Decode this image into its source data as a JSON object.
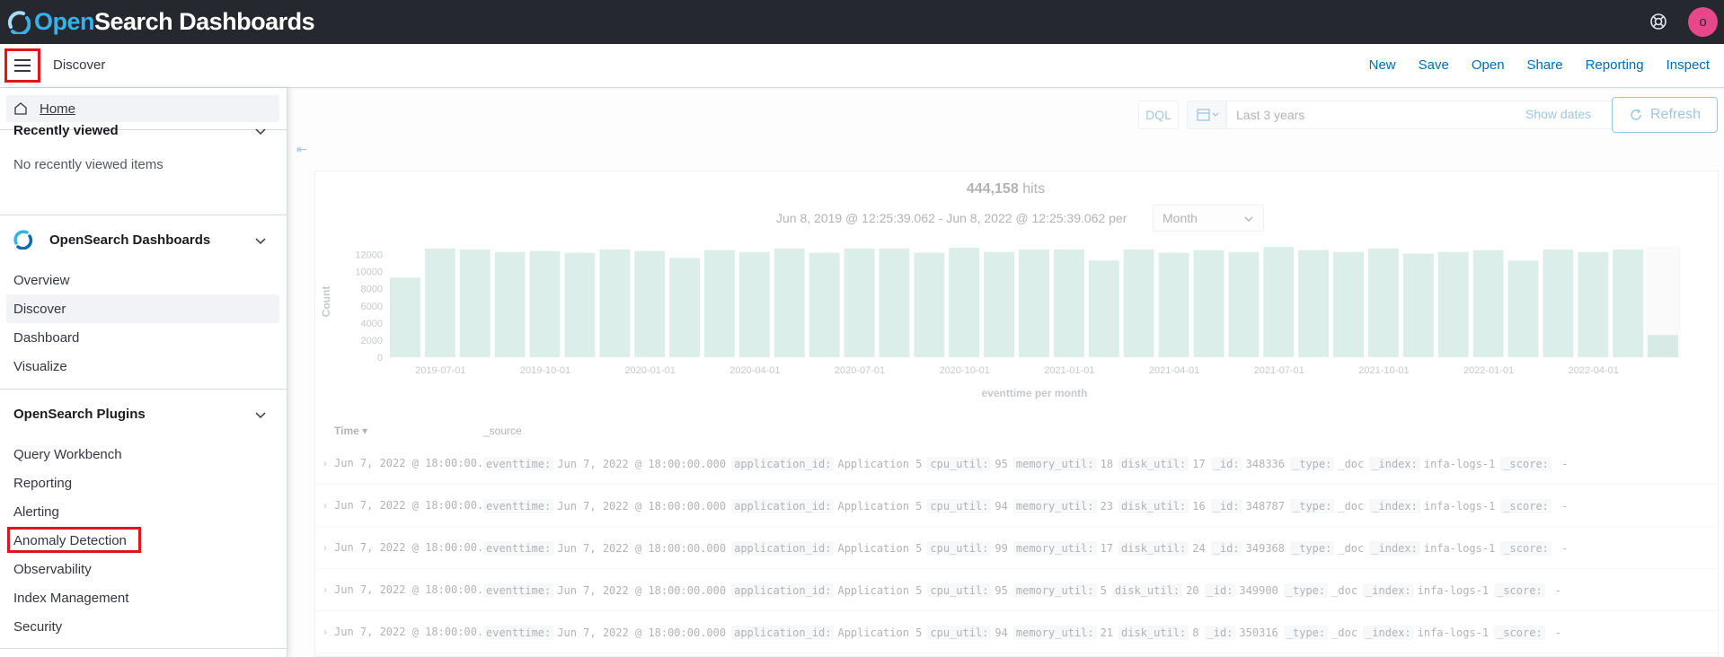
{
  "header": {
    "logo_open": "Open",
    "logo_rest": "Search Dashboards",
    "avatar_initial": "o"
  },
  "subheader": {
    "breadcrumb": "Discover",
    "actions": [
      "New",
      "Save",
      "Open",
      "Share",
      "Reporting",
      "Inspect"
    ]
  },
  "sidebar": {
    "home": "Home",
    "recently_viewed": {
      "title": "Recently viewed",
      "empty_text": "No recently viewed items"
    },
    "osd_section": {
      "title": "OpenSearch Dashboards",
      "items": [
        "Overview",
        "Discover",
        "Dashboard",
        "Visualize"
      ],
      "active_item": "Discover"
    },
    "plugins_section": {
      "title": "OpenSearch Plugins",
      "items": [
        "Query Workbench",
        "Reporting",
        "Alerting",
        "Anomaly Detection",
        "Observability",
        "Index Management",
        "Security"
      ],
      "highlighted_item": "Anomaly Detection"
    }
  },
  "query_bar": {
    "language": "DQL",
    "time_range": "Last 3 years",
    "show_dates": "Show dates",
    "refresh": "Refresh"
  },
  "histogram": {
    "hits_count": "444,158",
    "hits_label": "hits",
    "date_range": "Jun 8, 2019 @ 12:25:39.062 - Jun 8, 2022 @ 12:25:39.062 per",
    "interval": "Month",
    "chart_data": {
      "type": "bar",
      "ylabel": "Count",
      "xlabel": "eventtime per month",
      "ylim": [
        0,
        13000
      ],
      "yticks": [
        0,
        2000,
        4000,
        6000,
        8000,
        10000,
        12000
      ],
      "xtick_labels": [
        "2019-07-01",
        "2019-10-01",
        "2020-01-01",
        "2020-04-01",
        "2020-07-01",
        "2020-10-01",
        "2021-01-01",
        "2021-04-01",
        "2021-07-01",
        "2021-10-01",
        "2022-01-01",
        "2022-04-01"
      ],
      "values": [
        9300,
        12700,
        12600,
        12300,
        12400,
        12200,
        12600,
        12400,
        11600,
        12500,
        12300,
        12700,
        12200,
        12700,
        12700,
        12200,
        12800,
        12300,
        12600,
        12600,
        11300,
        12600,
        12200,
        12500,
        12300,
        12900,
        12500,
        12300,
        12700,
        12100,
        12300,
        12500,
        11300,
        12600,
        12300,
        12600,
        2600
      ]
    }
  },
  "table": {
    "time_header": "Time",
    "source_header": "_source",
    "rows": [
      {
        "time": "Jun 7, 2022 @ 18:00:00.000",
        "fields": [
          [
            "eventtime:",
            "Jun 7, 2022 @ 18:00:00.000"
          ],
          [
            "application_id:",
            "Application 5"
          ],
          [
            "cpu_util:",
            "95"
          ],
          [
            "memory_util:",
            "18"
          ],
          [
            "disk_util:",
            "17"
          ],
          [
            "_id:",
            "348336"
          ],
          [
            "_type:",
            "_doc"
          ],
          [
            "_index:",
            "infa-logs-1"
          ],
          [
            "_score:",
            " - "
          ]
        ]
      },
      {
        "time": "Jun 7, 2022 @ 18:00:00.000",
        "fields": [
          [
            "eventtime:",
            "Jun 7, 2022 @ 18:00:00.000"
          ],
          [
            "application_id:",
            "Application 5"
          ],
          [
            "cpu_util:",
            "94"
          ],
          [
            "memory_util:",
            "23"
          ],
          [
            "disk_util:",
            "16"
          ],
          [
            "_id:",
            "348787"
          ],
          [
            "_type:",
            "_doc"
          ],
          [
            "_index:",
            "infa-logs-1"
          ],
          [
            "_score:",
            " - "
          ]
        ]
      },
      {
        "time": "Jun 7, 2022 @ 18:00:00.000",
        "fields": [
          [
            "eventtime:",
            "Jun 7, 2022 @ 18:00:00.000"
          ],
          [
            "application_id:",
            "Application 5"
          ],
          [
            "cpu_util:",
            "99"
          ],
          [
            "memory_util:",
            "17"
          ],
          [
            "disk_util:",
            "24"
          ],
          [
            "_id:",
            "349368"
          ],
          [
            "_type:",
            "_doc"
          ],
          [
            "_index:",
            "infa-logs-1"
          ],
          [
            "_score:",
            " - "
          ]
        ]
      },
      {
        "time": "Jun 7, 2022 @ 18:00:00.000",
        "fields": [
          [
            "eventtime:",
            "Jun 7, 2022 @ 18:00:00.000"
          ],
          [
            "application_id:",
            "Application 5"
          ],
          [
            "cpu_util:",
            "95"
          ],
          [
            "memory_util:",
            "5"
          ],
          [
            "disk_util:",
            "20"
          ],
          [
            "_id:",
            "349900"
          ],
          [
            "_type:",
            "_doc"
          ],
          [
            "_index:",
            "infa-logs-1"
          ],
          [
            "_score:",
            " - "
          ]
        ]
      },
      {
        "time": "Jun 7, 2022 @ 18:00:00.000",
        "fields": [
          [
            "eventtime:",
            "Jun 7, 2022 @ 18:00:00.000"
          ],
          [
            "application_id:",
            "Application 5"
          ],
          [
            "cpu_util:",
            "94"
          ],
          [
            "memory_util:",
            "21"
          ],
          [
            "disk_util:",
            "8"
          ],
          [
            "_id:",
            "350316"
          ],
          [
            "_type:",
            "_doc"
          ],
          [
            "_index:",
            "infa-logs-1"
          ],
          [
            "_score:",
            " - "
          ]
        ]
      }
    ]
  },
  "colors": {
    "topbar": "#25282f",
    "brand_blue": "#34b3e9",
    "link": "#006bb8",
    "highlight_box": "#e2141c",
    "avatar": "#e8488b",
    "bar_fill": "#54b399"
  }
}
